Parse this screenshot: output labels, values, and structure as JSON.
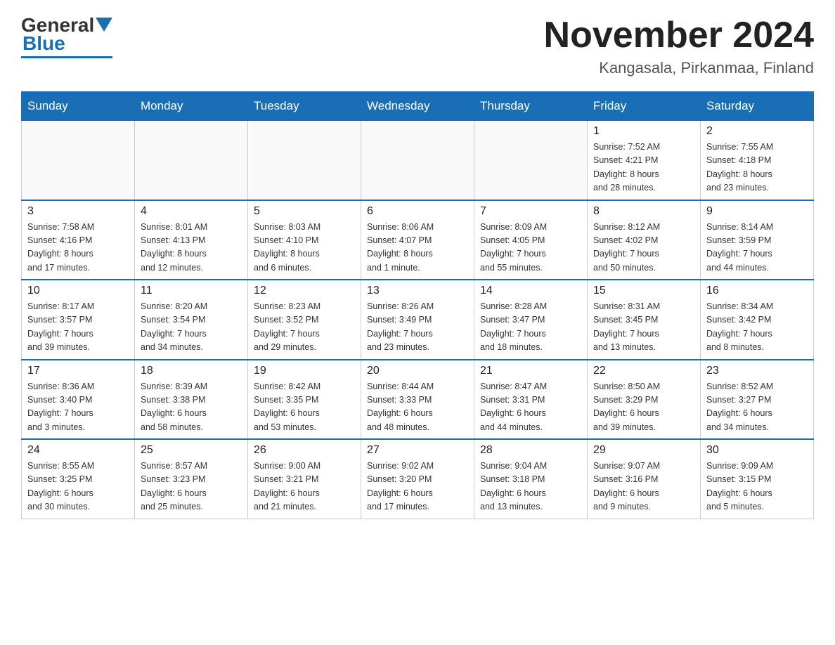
{
  "header": {
    "logo_general": "General",
    "logo_blue": "Blue",
    "month_title": "November 2024",
    "location": "Kangasala, Pirkanmaa, Finland"
  },
  "weekdays": [
    "Sunday",
    "Monday",
    "Tuesday",
    "Wednesday",
    "Thursday",
    "Friday",
    "Saturday"
  ],
  "weeks": [
    [
      {
        "day": "",
        "info": ""
      },
      {
        "day": "",
        "info": ""
      },
      {
        "day": "",
        "info": ""
      },
      {
        "day": "",
        "info": ""
      },
      {
        "day": "",
        "info": ""
      },
      {
        "day": "1",
        "info": "Sunrise: 7:52 AM\nSunset: 4:21 PM\nDaylight: 8 hours\nand 28 minutes."
      },
      {
        "day": "2",
        "info": "Sunrise: 7:55 AM\nSunset: 4:18 PM\nDaylight: 8 hours\nand 23 minutes."
      }
    ],
    [
      {
        "day": "3",
        "info": "Sunrise: 7:58 AM\nSunset: 4:16 PM\nDaylight: 8 hours\nand 17 minutes."
      },
      {
        "day": "4",
        "info": "Sunrise: 8:01 AM\nSunset: 4:13 PM\nDaylight: 8 hours\nand 12 minutes."
      },
      {
        "day": "5",
        "info": "Sunrise: 8:03 AM\nSunset: 4:10 PM\nDaylight: 8 hours\nand 6 minutes."
      },
      {
        "day": "6",
        "info": "Sunrise: 8:06 AM\nSunset: 4:07 PM\nDaylight: 8 hours\nand 1 minute."
      },
      {
        "day": "7",
        "info": "Sunrise: 8:09 AM\nSunset: 4:05 PM\nDaylight: 7 hours\nand 55 minutes."
      },
      {
        "day": "8",
        "info": "Sunrise: 8:12 AM\nSunset: 4:02 PM\nDaylight: 7 hours\nand 50 minutes."
      },
      {
        "day": "9",
        "info": "Sunrise: 8:14 AM\nSunset: 3:59 PM\nDaylight: 7 hours\nand 44 minutes."
      }
    ],
    [
      {
        "day": "10",
        "info": "Sunrise: 8:17 AM\nSunset: 3:57 PM\nDaylight: 7 hours\nand 39 minutes."
      },
      {
        "day": "11",
        "info": "Sunrise: 8:20 AM\nSunset: 3:54 PM\nDaylight: 7 hours\nand 34 minutes."
      },
      {
        "day": "12",
        "info": "Sunrise: 8:23 AM\nSunset: 3:52 PM\nDaylight: 7 hours\nand 29 minutes."
      },
      {
        "day": "13",
        "info": "Sunrise: 8:26 AM\nSunset: 3:49 PM\nDaylight: 7 hours\nand 23 minutes."
      },
      {
        "day": "14",
        "info": "Sunrise: 8:28 AM\nSunset: 3:47 PM\nDaylight: 7 hours\nand 18 minutes."
      },
      {
        "day": "15",
        "info": "Sunrise: 8:31 AM\nSunset: 3:45 PM\nDaylight: 7 hours\nand 13 minutes."
      },
      {
        "day": "16",
        "info": "Sunrise: 8:34 AM\nSunset: 3:42 PM\nDaylight: 7 hours\nand 8 minutes."
      }
    ],
    [
      {
        "day": "17",
        "info": "Sunrise: 8:36 AM\nSunset: 3:40 PM\nDaylight: 7 hours\nand 3 minutes."
      },
      {
        "day": "18",
        "info": "Sunrise: 8:39 AM\nSunset: 3:38 PM\nDaylight: 6 hours\nand 58 minutes."
      },
      {
        "day": "19",
        "info": "Sunrise: 8:42 AM\nSunset: 3:35 PM\nDaylight: 6 hours\nand 53 minutes."
      },
      {
        "day": "20",
        "info": "Sunrise: 8:44 AM\nSunset: 3:33 PM\nDaylight: 6 hours\nand 48 minutes."
      },
      {
        "day": "21",
        "info": "Sunrise: 8:47 AM\nSunset: 3:31 PM\nDaylight: 6 hours\nand 44 minutes."
      },
      {
        "day": "22",
        "info": "Sunrise: 8:50 AM\nSunset: 3:29 PM\nDaylight: 6 hours\nand 39 minutes."
      },
      {
        "day": "23",
        "info": "Sunrise: 8:52 AM\nSunset: 3:27 PM\nDaylight: 6 hours\nand 34 minutes."
      }
    ],
    [
      {
        "day": "24",
        "info": "Sunrise: 8:55 AM\nSunset: 3:25 PM\nDaylight: 6 hours\nand 30 minutes."
      },
      {
        "day": "25",
        "info": "Sunrise: 8:57 AM\nSunset: 3:23 PM\nDaylight: 6 hours\nand 25 minutes."
      },
      {
        "day": "26",
        "info": "Sunrise: 9:00 AM\nSunset: 3:21 PM\nDaylight: 6 hours\nand 21 minutes."
      },
      {
        "day": "27",
        "info": "Sunrise: 9:02 AM\nSunset: 3:20 PM\nDaylight: 6 hours\nand 17 minutes."
      },
      {
        "day": "28",
        "info": "Sunrise: 9:04 AM\nSunset: 3:18 PM\nDaylight: 6 hours\nand 13 minutes."
      },
      {
        "day": "29",
        "info": "Sunrise: 9:07 AM\nSunset: 3:16 PM\nDaylight: 6 hours\nand 9 minutes."
      },
      {
        "day": "30",
        "info": "Sunrise: 9:09 AM\nSunset: 3:15 PM\nDaylight: 6 hours\nand 5 minutes."
      }
    ]
  ]
}
